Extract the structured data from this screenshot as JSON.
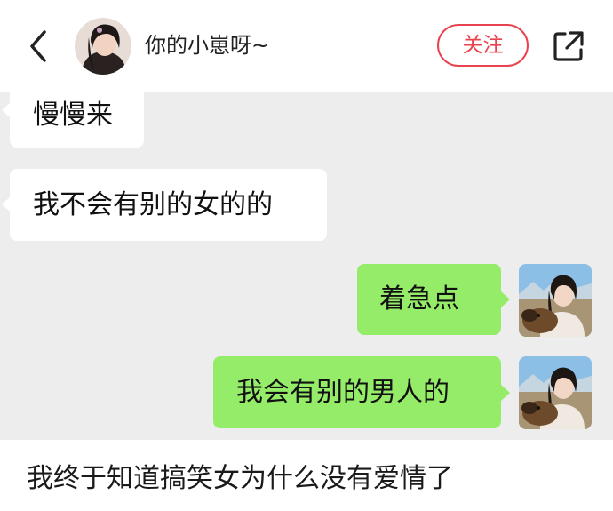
{
  "header": {
    "username": "你的小崽呀~",
    "follow_label": "关注"
  },
  "chat": {
    "messages": [
      {
        "side": "left",
        "text": "慢慢来"
      },
      {
        "side": "left",
        "text": "我不会有别的女的的"
      },
      {
        "side": "right",
        "text": "着急点"
      },
      {
        "side": "right",
        "text": "我会有别的男人的"
      }
    ]
  },
  "caption": "我终于知道搞笑女为什么没有爱情了",
  "colors": {
    "accent": "#e8434f",
    "chat_background": "#ededed",
    "sent_bubble": "#95ec69",
    "received_bubble": "#ffffff"
  },
  "icons": [
    "back-arrow-icon",
    "share-icon"
  ]
}
